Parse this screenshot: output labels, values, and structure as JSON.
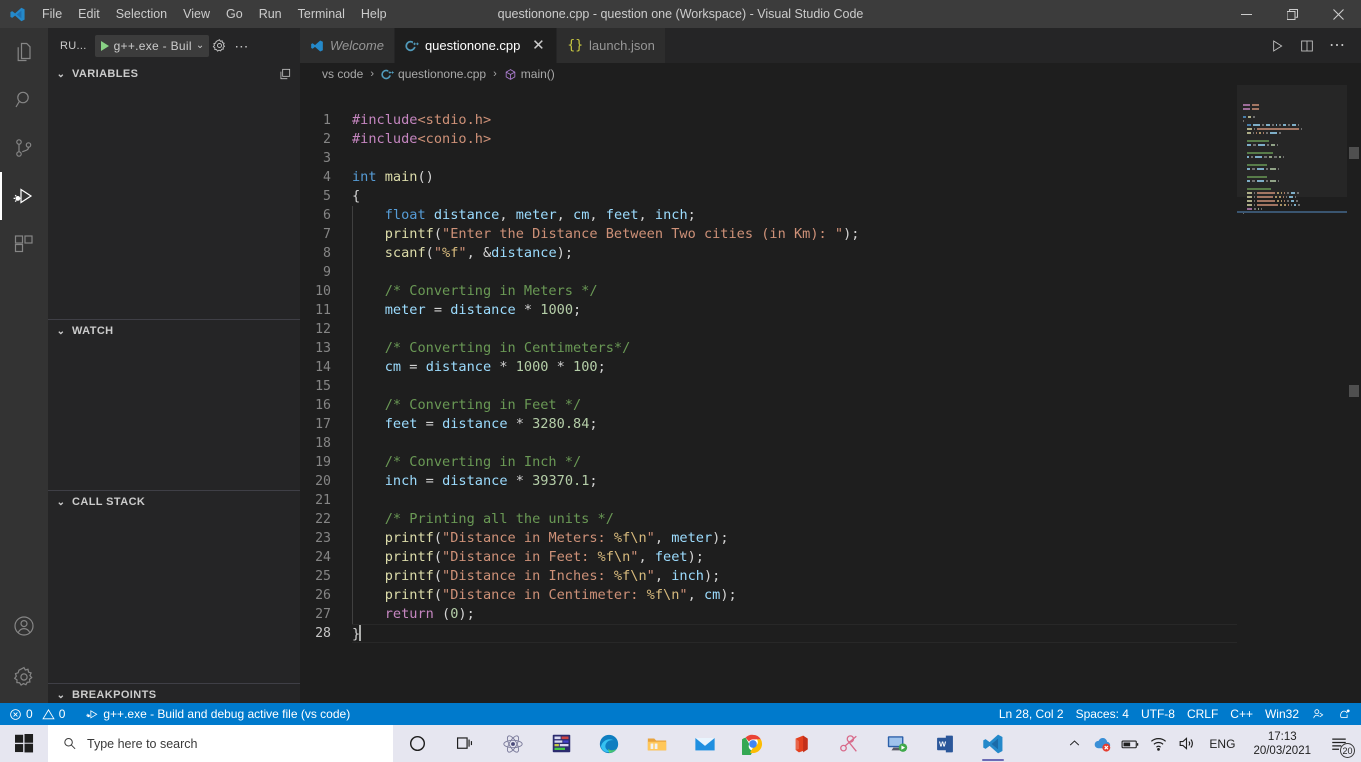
{
  "window": {
    "title": "questionone.cpp - question one (Workspace) - Visual Studio Code",
    "minimize": "–",
    "maximize": "❐",
    "close": "✕"
  },
  "menubar": {
    "items": [
      {
        "label": "File"
      },
      {
        "label": "Edit"
      },
      {
        "label": "Selection"
      },
      {
        "label": "View"
      },
      {
        "label": "Go"
      },
      {
        "label": "Run"
      },
      {
        "label": "Terminal"
      },
      {
        "label": "Help"
      }
    ]
  },
  "activitybar": {
    "items": [
      {
        "name": "explorer",
        "icon": "files-icon",
        "active": false
      },
      {
        "name": "search",
        "icon": "search-icon",
        "active": false
      },
      {
        "name": "source-control",
        "icon": "source-control-icon",
        "active": false
      },
      {
        "name": "run-and-debug",
        "icon": "run-debug-icon",
        "active": true
      },
      {
        "name": "extensions",
        "icon": "extensions-icon",
        "active": false
      }
    ],
    "bottom": [
      {
        "name": "accounts",
        "icon": "account-icon"
      },
      {
        "name": "settings",
        "icon": "gear-icon"
      }
    ]
  },
  "sidebar": {
    "header_label": "RU...",
    "run_config": "g++.exe - Buil",
    "run_config_chevron": "⌄",
    "gear_tooltip": "Open launch.json",
    "more_label": "⋯",
    "sections": [
      {
        "label": "VARIABLES",
        "chevron": "⌄",
        "has_action": true
      },
      {
        "label": "WATCH",
        "chevron": "⌄",
        "has_action": false
      },
      {
        "label": "CALL STACK",
        "chevron": "⌄",
        "has_action": false
      },
      {
        "label": "BREAKPOINTS",
        "chevron": "⌄",
        "has_action": false
      }
    ]
  },
  "tabs": [
    {
      "label": "Welcome",
      "icon": "vscode-icon",
      "active": false,
      "italic": true,
      "closable": false
    },
    {
      "label": "questionone.cpp",
      "icon": "cpp-icon",
      "active": true,
      "italic": false,
      "closable": true,
      "close": "✕"
    },
    {
      "label": "launch.json",
      "icon": "json-icon",
      "active": false,
      "italic": false,
      "closable": false
    }
  ],
  "tab_actions": [
    {
      "name": "run-code-button",
      "icon": "play-icon"
    },
    {
      "name": "split-editor-button",
      "icon": "split-editor-icon"
    },
    {
      "name": "more-actions-button",
      "icon": "ellipsis-icon",
      "label": "⋯"
    }
  ],
  "breadcrumbs": [
    {
      "label": "vs code",
      "icon": null
    },
    {
      "label": "questionone.cpp",
      "icon": "cpp-icon"
    },
    {
      "label": "main()",
      "icon": "symbol-method-icon"
    }
  ],
  "breadcrumb_separator": "›",
  "editor": {
    "language": "C++",
    "lines": [
      {
        "n": 1,
        "indent": 0,
        "tokens": [
          {
            "t": "#include",
            "c": "t-pre"
          },
          {
            "t": "<stdio.h>",
            "c": "t-hdr"
          }
        ]
      },
      {
        "n": 2,
        "indent": 0,
        "tokens": [
          {
            "t": "#include",
            "c": "t-pre"
          },
          {
            "t": "<conio.h>",
            "c": "t-hdr"
          }
        ]
      },
      {
        "n": 3,
        "indent": 0,
        "tokens": []
      },
      {
        "n": 4,
        "indent": 0,
        "tokens": [
          {
            "t": "int",
            "c": "t-type"
          },
          {
            "t": " ",
            "c": "t-op"
          },
          {
            "t": "main",
            "c": "t-fn"
          },
          {
            "t": "()",
            "c": "t-punct"
          }
        ]
      },
      {
        "n": 5,
        "indent": 0,
        "tokens": [
          {
            "t": "{",
            "c": "t-punct"
          }
        ]
      },
      {
        "n": 6,
        "indent": 1,
        "tokens": [
          {
            "t": "    ",
            "c": "t-op"
          },
          {
            "t": "float",
            "c": "t-type"
          },
          {
            "t": " ",
            "c": "t-op"
          },
          {
            "t": "distance",
            "c": "t-var"
          },
          {
            "t": ", ",
            "c": "t-punct"
          },
          {
            "t": "meter",
            "c": "t-var"
          },
          {
            "t": ", ",
            "c": "t-punct"
          },
          {
            "t": "cm",
            "c": "t-var"
          },
          {
            "t": ", ",
            "c": "t-punct"
          },
          {
            "t": "feet",
            "c": "t-var"
          },
          {
            "t": ", ",
            "c": "t-punct"
          },
          {
            "t": "inch",
            "c": "t-var"
          },
          {
            "t": ";",
            "c": "t-punct"
          }
        ]
      },
      {
        "n": 7,
        "indent": 1,
        "tokens": [
          {
            "t": "    ",
            "c": "t-op"
          },
          {
            "t": "printf",
            "c": "t-fn"
          },
          {
            "t": "(",
            "c": "t-punct"
          },
          {
            "t": "\"Enter the Distance Between Two cities (in Km): \"",
            "c": "t-str"
          },
          {
            "t": ");",
            "c": "t-punct"
          }
        ]
      },
      {
        "n": 8,
        "indent": 1,
        "tokens": [
          {
            "t": "    ",
            "c": "t-op"
          },
          {
            "t": "scanf",
            "c": "t-fn"
          },
          {
            "t": "(",
            "c": "t-punct"
          },
          {
            "t": "\"",
            "c": "t-str"
          },
          {
            "t": "%f",
            "c": "t-esc"
          },
          {
            "t": "\"",
            "c": "t-str"
          },
          {
            "t": ", &",
            "c": "t-punct"
          },
          {
            "t": "distance",
            "c": "t-var"
          },
          {
            "t": ");",
            "c": "t-punct"
          }
        ]
      },
      {
        "n": 9,
        "indent": 1,
        "tokens": []
      },
      {
        "n": 10,
        "indent": 1,
        "tokens": [
          {
            "t": "    ",
            "c": "t-op"
          },
          {
            "t": "/* Converting in Meters */",
            "c": "t-cmt"
          }
        ]
      },
      {
        "n": 11,
        "indent": 1,
        "tokens": [
          {
            "t": "    ",
            "c": "t-op"
          },
          {
            "t": "meter",
            "c": "t-var"
          },
          {
            "t": " = ",
            "c": "t-op"
          },
          {
            "t": "distance",
            "c": "t-var"
          },
          {
            "t": " * ",
            "c": "t-op"
          },
          {
            "t": "1000",
            "c": "t-num"
          },
          {
            "t": ";",
            "c": "t-punct"
          }
        ]
      },
      {
        "n": 12,
        "indent": 1,
        "tokens": []
      },
      {
        "n": 13,
        "indent": 1,
        "tokens": [
          {
            "t": "    ",
            "c": "t-op"
          },
          {
            "t": "/* Converting in Centimeters*/",
            "c": "t-cmt"
          }
        ]
      },
      {
        "n": 14,
        "indent": 1,
        "tokens": [
          {
            "t": "    ",
            "c": "t-op"
          },
          {
            "t": "cm",
            "c": "t-var"
          },
          {
            "t": " = ",
            "c": "t-op"
          },
          {
            "t": "distance",
            "c": "t-var"
          },
          {
            "t": " * ",
            "c": "t-op"
          },
          {
            "t": "1000",
            "c": "t-num"
          },
          {
            "t": " * ",
            "c": "t-op"
          },
          {
            "t": "100",
            "c": "t-num"
          },
          {
            "t": ";",
            "c": "t-punct"
          }
        ]
      },
      {
        "n": 15,
        "indent": 1,
        "tokens": []
      },
      {
        "n": 16,
        "indent": 1,
        "tokens": [
          {
            "t": "    ",
            "c": "t-op"
          },
          {
            "t": "/* Converting in Feet */",
            "c": "t-cmt"
          }
        ]
      },
      {
        "n": 17,
        "indent": 1,
        "tokens": [
          {
            "t": "    ",
            "c": "t-op"
          },
          {
            "t": "feet",
            "c": "t-var"
          },
          {
            "t": " = ",
            "c": "t-op"
          },
          {
            "t": "distance",
            "c": "t-var"
          },
          {
            "t": " * ",
            "c": "t-op"
          },
          {
            "t": "3280.84",
            "c": "t-num"
          },
          {
            "t": ";",
            "c": "t-punct"
          }
        ]
      },
      {
        "n": 18,
        "indent": 1,
        "tokens": []
      },
      {
        "n": 19,
        "indent": 1,
        "tokens": [
          {
            "t": "    ",
            "c": "t-op"
          },
          {
            "t": "/* Converting in Inch */",
            "c": "t-cmt"
          }
        ]
      },
      {
        "n": 20,
        "indent": 1,
        "tokens": [
          {
            "t": "    ",
            "c": "t-op"
          },
          {
            "t": "inch",
            "c": "t-var"
          },
          {
            "t": " = ",
            "c": "t-op"
          },
          {
            "t": "distance",
            "c": "t-var"
          },
          {
            "t": " * ",
            "c": "t-op"
          },
          {
            "t": "39370.1",
            "c": "t-num"
          },
          {
            "t": ";",
            "c": "t-punct"
          }
        ]
      },
      {
        "n": 21,
        "indent": 1,
        "tokens": []
      },
      {
        "n": 22,
        "indent": 1,
        "tokens": [
          {
            "t": "    ",
            "c": "t-op"
          },
          {
            "t": "/* Printing all the units */",
            "c": "t-cmt"
          }
        ]
      },
      {
        "n": 23,
        "indent": 1,
        "tokens": [
          {
            "t": "    ",
            "c": "t-op"
          },
          {
            "t": "printf",
            "c": "t-fn"
          },
          {
            "t": "(",
            "c": "t-punct"
          },
          {
            "t": "\"Distance in Meters: ",
            "c": "t-str"
          },
          {
            "t": "%f",
            "c": "t-esc"
          },
          {
            "t": "\\n",
            "c": "t-esc"
          },
          {
            "t": "\"",
            "c": "t-str"
          },
          {
            "t": ", ",
            "c": "t-punct"
          },
          {
            "t": "meter",
            "c": "t-var"
          },
          {
            "t": ");",
            "c": "t-punct"
          }
        ]
      },
      {
        "n": 24,
        "indent": 1,
        "tokens": [
          {
            "t": "    ",
            "c": "t-op"
          },
          {
            "t": "printf",
            "c": "t-fn"
          },
          {
            "t": "(",
            "c": "t-punct"
          },
          {
            "t": "\"Distance in Feet: ",
            "c": "t-str"
          },
          {
            "t": "%f",
            "c": "t-esc"
          },
          {
            "t": "\\n",
            "c": "t-esc"
          },
          {
            "t": "\"",
            "c": "t-str"
          },
          {
            "t": ", ",
            "c": "t-punct"
          },
          {
            "t": "feet",
            "c": "t-var"
          },
          {
            "t": ");",
            "c": "t-punct"
          }
        ]
      },
      {
        "n": 25,
        "indent": 1,
        "tokens": [
          {
            "t": "    ",
            "c": "t-op"
          },
          {
            "t": "printf",
            "c": "t-fn"
          },
          {
            "t": "(",
            "c": "t-punct"
          },
          {
            "t": "\"Distance in Inches: ",
            "c": "t-str"
          },
          {
            "t": "%f",
            "c": "t-esc"
          },
          {
            "t": "\\n",
            "c": "t-esc"
          },
          {
            "t": "\"",
            "c": "t-str"
          },
          {
            "t": ", ",
            "c": "t-punct"
          },
          {
            "t": "inch",
            "c": "t-var"
          },
          {
            "t": ");",
            "c": "t-punct"
          }
        ]
      },
      {
        "n": 26,
        "indent": 1,
        "tokens": [
          {
            "t": "    ",
            "c": "t-op"
          },
          {
            "t": "printf",
            "c": "t-fn"
          },
          {
            "t": "(",
            "c": "t-punct"
          },
          {
            "t": "\"Distance in Centimeter: ",
            "c": "t-str"
          },
          {
            "t": "%f",
            "c": "t-esc"
          },
          {
            "t": "\\n",
            "c": "t-esc"
          },
          {
            "t": "\"",
            "c": "t-str"
          },
          {
            "t": ", ",
            "c": "t-punct"
          },
          {
            "t": "cm",
            "c": "t-var"
          },
          {
            "t": ");",
            "c": "t-punct"
          }
        ]
      },
      {
        "n": 27,
        "indent": 1,
        "tokens": [
          {
            "t": "    ",
            "c": "t-op"
          },
          {
            "t": "return",
            "c": "t-kw"
          },
          {
            "t": " (",
            "c": "t-punct"
          },
          {
            "t": "0",
            "c": "t-num"
          },
          {
            "t": ");",
            "c": "t-punct"
          }
        ]
      },
      {
        "n": 28,
        "indent": 0,
        "current": true,
        "tokens": [
          {
            "t": "}",
            "c": "t-punct"
          }
        ]
      }
    ]
  },
  "statusbar": {
    "left": [
      {
        "name": "problems",
        "icon": "error-warning-icon",
        "errors": "0",
        "warnings": "0"
      },
      {
        "name": "debug-target",
        "icon": "debug-alt-icon",
        "label": "g++.exe - Build and debug active file (vs code)"
      }
    ],
    "right": [
      {
        "name": "editor-position",
        "label": "Ln 28, Col 2"
      },
      {
        "name": "editor-indentation",
        "label": "Spaces: 4"
      },
      {
        "name": "editor-encoding",
        "label": "UTF-8"
      },
      {
        "name": "editor-eol",
        "label": "CRLF"
      },
      {
        "name": "editor-language",
        "label": "C++"
      },
      {
        "name": "editor-platform",
        "label": "Win32"
      },
      {
        "name": "live-share",
        "icon": "live-share-icon"
      },
      {
        "name": "notifications",
        "icon": "bell-icon"
      }
    ],
    "accent_color": "#007acc"
  },
  "taskbar": {
    "start": "start-icon",
    "search_placeholder": "Type here to search",
    "icons": [
      {
        "name": "cortana",
        "icon": "cortana-icon"
      },
      {
        "name": "task-view",
        "icon": "task-view-icon"
      },
      {
        "name": "app-react",
        "icon": "atom-icon"
      },
      {
        "name": "app-code-blocks",
        "icon": "codeblocks-icon"
      },
      {
        "name": "microsoft-edge",
        "icon": "edge-icon"
      },
      {
        "name": "file-explorer",
        "icon": "folder-icon"
      },
      {
        "name": "mail",
        "icon": "mail-icon"
      },
      {
        "name": "google-chrome",
        "icon": "chrome-icon"
      },
      {
        "name": "microsoft-office",
        "icon": "office-icon"
      },
      {
        "name": "snipping-tool",
        "icon": "scissors-icon"
      },
      {
        "name": "remote-desktop",
        "icon": "remote-desktop-icon"
      },
      {
        "name": "microsoft-word",
        "icon": "word-icon"
      },
      {
        "name": "visual-studio-code",
        "icon": "vscode-icon",
        "running": true
      }
    ],
    "tray": {
      "expand": "⌃",
      "items": [
        {
          "name": "onedrive-error",
          "icon": "cloud-error-icon"
        },
        {
          "name": "battery",
          "icon": "battery-icon"
        },
        {
          "name": "network",
          "icon": "wifi-icon"
        },
        {
          "name": "volume",
          "icon": "speaker-icon"
        }
      ],
      "language": "ENG",
      "time": "17:13",
      "date": "20/03/2021",
      "notification_count": "20"
    }
  },
  "colors": {
    "title_bar": "#3c3c3c",
    "activity_bar": "#333333",
    "sidebar": "#252526",
    "editor": "#1e1e1e",
    "tab_active": "#1e1e1e",
    "tab_inactive": "#2d2d2d",
    "status_bar": "#007acc",
    "taskbar": "#e6e6f0"
  }
}
